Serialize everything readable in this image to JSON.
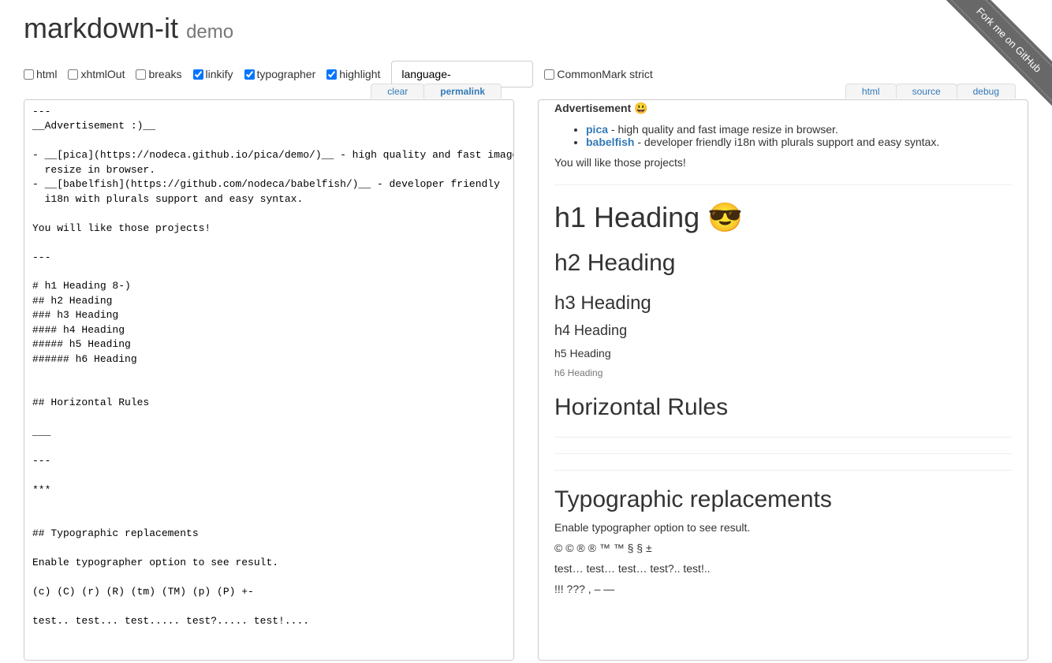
{
  "ribbon": "Fork me on GitHub",
  "header": {
    "title": "markdown-it",
    "subtitle": "demo"
  },
  "options": {
    "html": {
      "label": "html",
      "checked": false
    },
    "xhtmlOut": {
      "label": "xhtmlOut",
      "checked": false
    },
    "breaks": {
      "label": "breaks",
      "checked": false
    },
    "linkify": {
      "label": "linkify",
      "checked": true
    },
    "typographer": {
      "label": "typographer",
      "checked": true
    },
    "highlight": {
      "label": "highlight",
      "checked": true
    },
    "langInput": {
      "value": "language-"
    },
    "commonmark": {
      "label": "CommonMark strict",
      "checked": false
    }
  },
  "leftTabs": {
    "clear": "clear",
    "permalink": "permalink"
  },
  "rightTabs": {
    "html": "html",
    "source": "source",
    "debug": "debug"
  },
  "source": "---\n__Advertisement :)__\n\n- __[pica](https://nodeca.github.io/pica/demo/)__ - high quality and fast image\n  resize in browser.\n- __[babelfish](https://github.com/nodeca/babelfish/)__ - developer friendly\n  i18n with plurals support and easy syntax.\n\nYou will like those projects!\n\n---\n\n# h1 Heading 8-)\n## h2 Heading\n### h3 Heading\n#### h4 Heading\n##### h5 Heading\n###### h6 Heading\n\n\n## Horizontal Rules\n\n___\n\n---\n\n***\n\n\n## Typographic replacements\n\nEnable typographer option to see result.\n\n(c) (C) (r) (R) (tm) (TM) (p) (P) +-\n\ntest.. test... test..... test?..... test!....",
  "rendered": {
    "ad_strong": "Advertisement",
    "ad_emoji": "😃",
    "li1_link": "pica",
    "li1_text": " - high quality and fast image resize in browser.",
    "li2_link": "babelfish",
    "li2_text": " - developer friendly i18n with plurals support and easy syntax.",
    "like": "You will like those projects!",
    "h1_text": "h1 Heading ",
    "h1_emoji": "😎",
    "h2": "h2 Heading",
    "h3": "h3 Heading",
    "h4": "h4 Heading",
    "h5": "h5 Heading",
    "h6": "h6 Heading",
    "hr_title": "Horizontal Rules",
    "typo_title": "Typographic replacements",
    "typo_desc": "Enable typographer option to see result.",
    "typo_line1": "© © ® ® ™ ™ § § ±",
    "typo_line2": "test… test… test… test?.. test!..",
    "typo_line3": "!!! ??? , – —"
  }
}
